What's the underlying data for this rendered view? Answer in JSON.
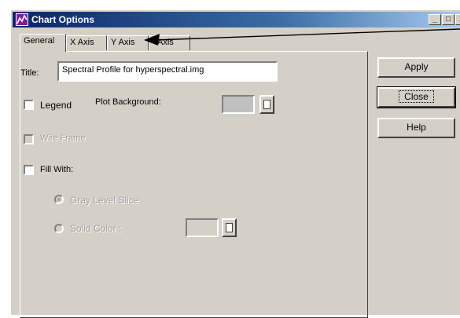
{
  "window": {
    "title": "Chart Options",
    "controls": {
      "minimize": "_",
      "maximize": "□",
      "close": "x"
    }
  },
  "tabs": [
    {
      "label": "General",
      "active": true
    },
    {
      "label": "X Axis",
      "active": false
    },
    {
      "label": "Y Axis",
      "active": false
    },
    {
      "label": "Axis",
      "active": false
    }
  ],
  "general": {
    "title_label": "Title:",
    "title_value": "Spectral Profile for hyperspectral.img",
    "legend_label": "Legend",
    "legend_checked": false,
    "plot_background_label": "Plot Background:",
    "wire_frame_label": "Wire Frame",
    "fill_with_label": "Fill With:",
    "gray_level_slice_label": "Gray Level Slice",
    "solid_color_label": "Solid Color :"
  },
  "buttons": {
    "apply": "Apply",
    "close": "Close",
    "help": "Help"
  },
  "colors": {
    "face": "#d4d0c8",
    "swatch": "#c0c0c0"
  }
}
